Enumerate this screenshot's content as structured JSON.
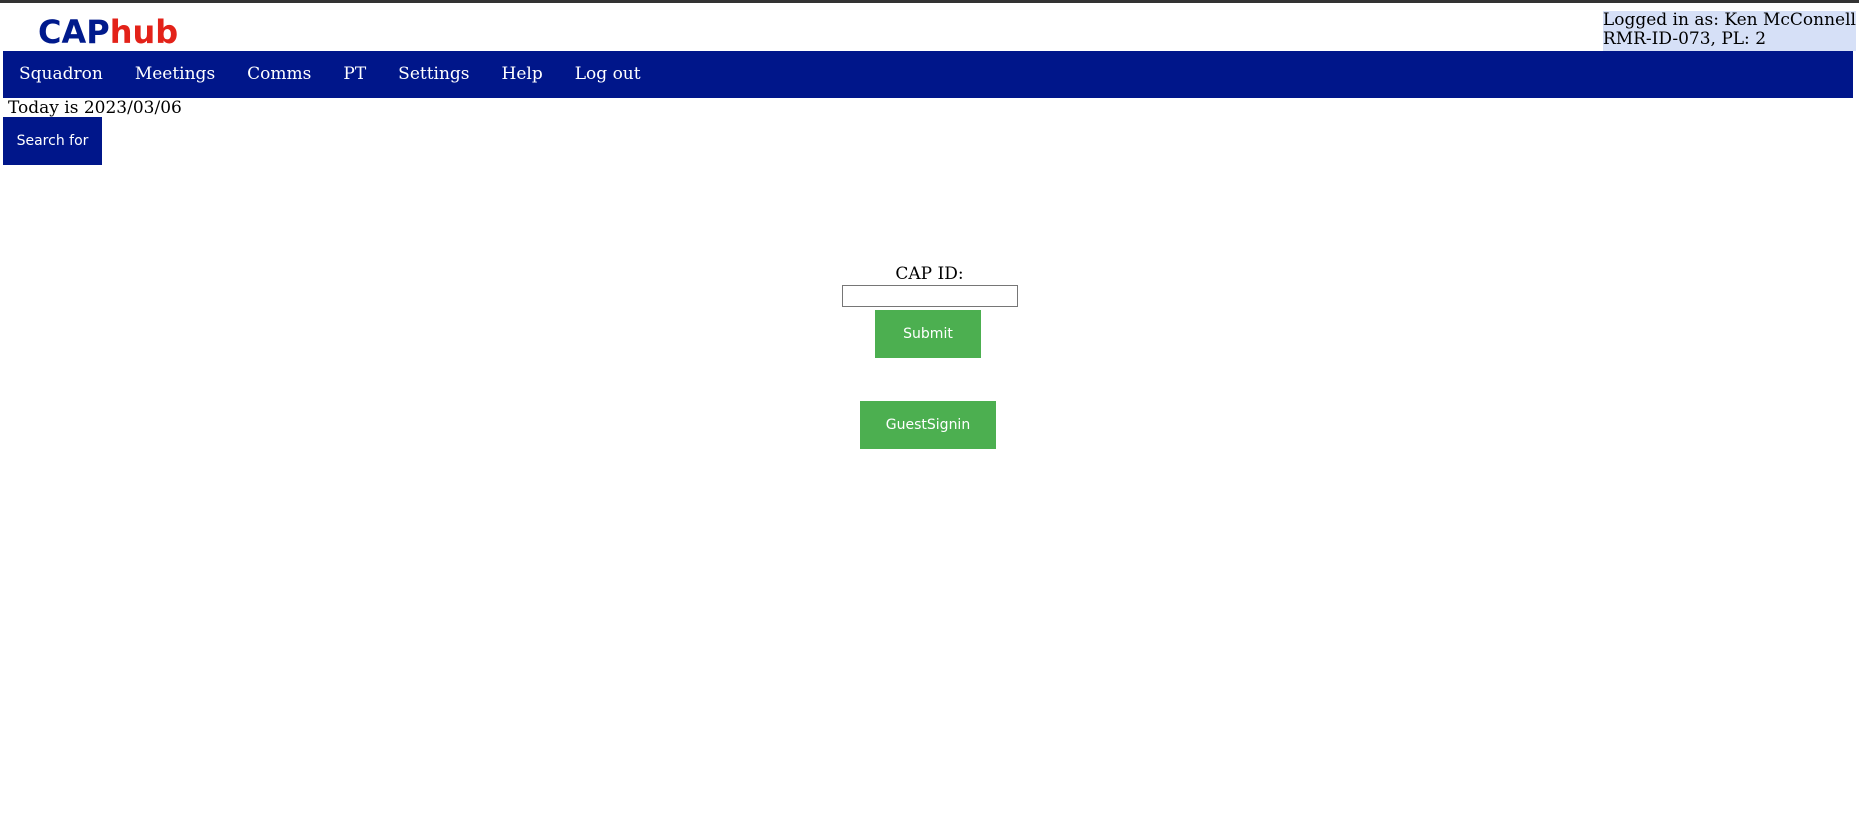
{
  "brand": {
    "logo_part1": "CAP",
    "logo_part2": "hub",
    "color_primary": "#001a8c",
    "color_accent": "#e32219"
  },
  "user": {
    "line1": "Logged in as: Ken McConnell",
    "line2": "RMR-ID-073, PL: 2"
  },
  "nav": {
    "items": [
      {
        "label": "Squadron"
      },
      {
        "label": "Meetings"
      },
      {
        "label": "Comms"
      },
      {
        "label": "PT"
      },
      {
        "label": "Settings"
      },
      {
        "label": "Help"
      },
      {
        "label": "Log out"
      }
    ]
  },
  "main": {
    "today": "Today is 2023/03/06",
    "search_label": "Search for",
    "cap_id_label": "CAP ID:",
    "cap_id_value": "",
    "submit_label": "Submit",
    "guest_label": "GuestSignin"
  }
}
